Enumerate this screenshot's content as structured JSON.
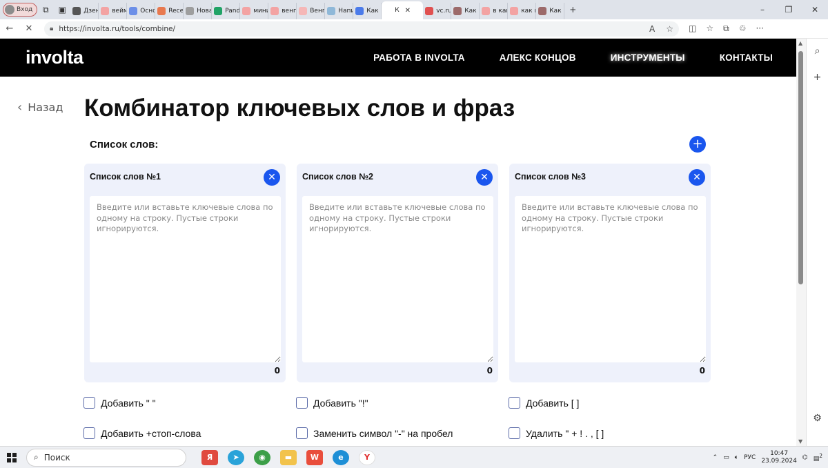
{
  "browser": {
    "profile_label": "Вход",
    "tabs": [
      {
        "title": "Дзен",
        "icon": "plus-circle-icon",
        "color": "#555555"
      },
      {
        "title": "веймо",
        "icon": "yandex-icon",
        "color": "#f3a3a3"
      },
      {
        "title": "Основ",
        "icon": "globe-icon",
        "color": "#6c8fe8"
      },
      {
        "title": "Recen",
        "icon": "figma-icon",
        "color": "#e8794f"
      },
      {
        "title": "Новая",
        "icon": "page-icon",
        "color": "#9e9e9e"
      },
      {
        "title": "Panda",
        "icon": "plus-square-icon",
        "color": "#21a366"
      },
      {
        "title": "миним",
        "icon": "yandex-icon",
        "color": "#f3a3a3"
      },
      {
        "title": "венге",
        "icon": "yandex-icon",
        "color": "#f3a3a3"
      },
      {
        "title": "Венге",
        "icon": "paw-icon",
        "color": "#f5b7b7"
      },
      {
        "title": "Напи",
        "icon": "brand-icon",
        "color": "#8fb8d8"
      },
      {
        "title": "Как и",
        "icon": "docs-icon",
        "color": "#4b7bea"
      },
      {
        "title": "К",
        "icon": "involta-icon",
        "color": "#ffffff",
        "active": true
      },
      {
        "title": "vc.ru -",
        "icon": "yandex-icon",
        "color": "#e05050"
      },
      {
        "title": "Как и",
        "icon": "news-icon",
        "color": "#9c6a6a"
      },
      {
        "title": "в како",
        "icon": "yandex-icon",
        "color": "#f3a3a3"
      },
      {
        "title": "как пи",
        "icon": "yandex-icon",
        "color": "#f3a3a3"
      },
      {
        "title": "Как н",
        "icon": "news-icon",
        "color": "#9c6a6a"
      }
    ],
    "url": "https://involta.ru/tools/combine/"
  },
  "site": {
    "logo": "involta",
    "nav": [
      {
        "label": "РАБОТА В INVOLTA"
      },
      {
        "label": "АЛЕКС КОНЦОВ"
      },
      {
        "label": "ИНСТРУМЕНТЫ",
        "active": true
      },
      {
        "label": "КОНТАКТЫ"
      }
    ]
  },
  "page": {
    "back_label": "Назад",
    "title": "Комбинатор ключевых слов и фраз",
    "list_heading": "Список слов:",
    "cards": [
      {
        "title": "Список слов №1",
        "placeholder": "Введите или вставьте ключевые слова по одному на строку. Пустые строки игнорируются.",
        "count": "0"
      },
      {
        "title": "Список слов №2",
        "placeholder": "Введите или вставьте ключевые слова по одному на строку. Пустые строки игнорируются.",
        "count": "0"
      },
      {
        "title": "Список слов №3",
        "placeholder": "Введите или вставьте ключевые слова по одному на строку. Пустые строки игнорируются.",
        "count": "0"
      }
    ],
    "options": [
      {
        "label": "Добавить \" \""
      },
      {
        "label": "Добавить \"!\""
      },
      {
        "label": "Добавить [ ]"
      },
      {
        "label": "Добавить +стоп-слова"
      },
      {
        "label": "Заменить символ \"-\" на пробел"
      },
      {
        "label": "Удалить \" + ! . , [ ]"
      }
    ]
  },
  "taskbar": {
    "search_label": "Поиск",
    "lang": "РУС",
    "time": "10:47",
    "date": "23.09.2024",
    "notification_count": "2"
  },
  "colors": {
    "accent": "#1a56ee",
    "card_bg": "#eef1fb",
    "header_bg": "#000000"
  }
}
